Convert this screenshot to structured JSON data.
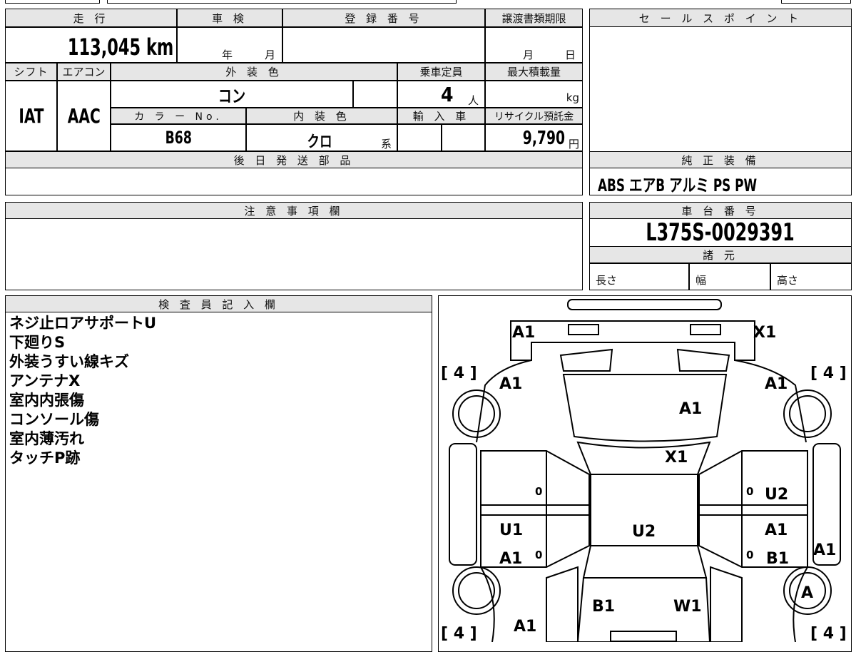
{
  "top_table": {
    "mileage_label": "走 行",
    "mileage_value": "113,045 km",
    "inspection_label": "車 検",
    "inspection_year_unit": "年",
    "inspection_month_unit": "月",
    "registration_label": "登 録 番 号",
    "transfer_deadline_label": "譲渡書類期限",
    "transfer_month_unit": "月",
    "transfer_day_unit": "日",
    "shift_label": "シフト",
    "shift_value": "IAT",
    "ac_label": "エアコン",
    "ac_value": "AAC",
    "exterior_color_label": "外 装 色",
    "exterior_color_value": "コン",
    "capacity_label": "乗車定員",
    "capacity_value": "4",
    "capacity_unit": "人",
    "max_load_label": "最大積載量",
    "max_load_unit": "kg",
    "color_no_label": "カ ラ ー No.",
    "color_no_value": "B68",
    "interior_color_label": "内 装 色",
    "interior_color_value": "クロ",
    "interior_color_suffix": "系",
    "import_label": "輸 入 車",
    "recycle_label": "リサイクル預託金",
    "recycle_value": "9,790",
    "recycle_unit": "円",
    "later_parts_label": "後 日 発 送 部 品"
  },
  "right_panel": {
    "sales_points_label": "セ ー ル ス ポ イ ン ト",
    "equipment_label": "純 正 装 備",
    "equipment_value": "ABS エアB アルミ PS PW",
    "chassis_label": "車 台 番 号",
    "chassis_value": "L375S-0029391",
    "spec_label": "諸 元",
    "length_label": "長さ",
    "width_label": "幅",
    "height_label": "高さ"
  },
  "notes": {
    "label": "注 意 事 項 欄"
  },
  "inspector": {
    "label": "検 査 員 記 入 欄",
    "lines": [
      "ネジ止ロアサポートU",
      "下廻りS",
      "外装うすい線キズ",
      "アンテナX",
      "室内内張傷",
      "コンソール傷",
      "室内薄汚れ",
      "タッチP跡"
    ]
  },
  "diagram": {
    "tire_left_top": "[ 4 ]",
    "tire_right_top": "[ 4 ]",
    "tire_left_bottom": "[ 4 ]",
    "tire_right_bottom": "[ 4 ]",
    "front_bumper_left": "A1",
    "front_bumper_right": "X1",
    "front_fender_left": "A1",
    "front_fender_right": "A1",
    "hood": "A1",
    "windshield": "X1",
    "left_front_door_zero": "0",
    "right_front_door_zero": "0",
    "right_front_door": "U2",
    "roof": "U2",
    "left_rear_door_top": "U1",
    "left_rear_door_bottom": "A1",
    "left_rear_zero": "0",
    "right_rear_door_top": "A1",
    "right_rear_zero": "0",
    "right_rear_door_bottom": "B1",
    "right_side_sill": "A1",
    "right_rear_wheel": "A",
    "rear_left": "B1",
    "rear_right": "W1",
    "rear_bumper_left": "A1"
  }
}
